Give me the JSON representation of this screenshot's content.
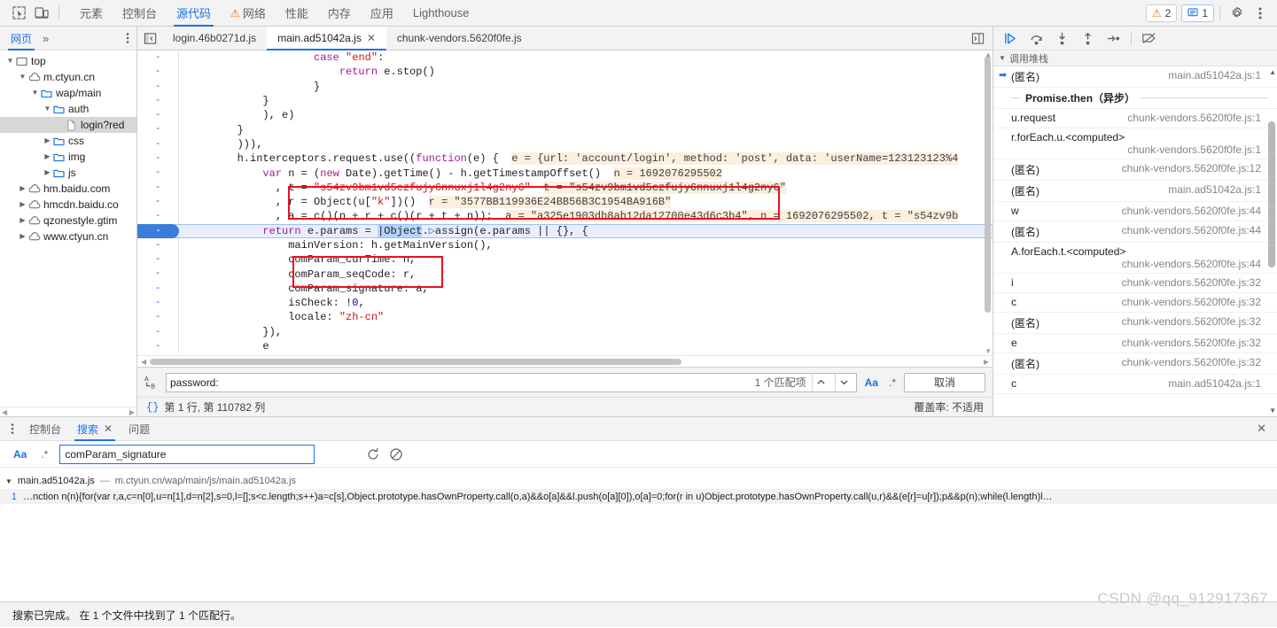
{
  "toolbar": {
    "inspect_icon": "inspect-cursor-icon",
    "device_icon": "device-toolbar-icon",
    "panels": [
      {
        "label": "元素",
        "selected": false,
        "warn": false
      },
      {
        "label": "控制台",
        "selected": false,
        "warn": false
      },
      {
        "label": "源代码",
        "selected": true,
        "warn": false
      },
      {
        "label": "网络",
        "selected": false,
        "warn": true
      },
      {
        "label": "性能",
        "selected": false,
        "warn": false
      },
      {
        "label": "内存",
        "selected": false,
        "warn": false
      },
      {
        "label": "应用",
        "selected": false,
        "warn": false
      },
      {
        "label": "Lighthouse",
        "selected": false,
        "warn": false
      }
    ],
    "warning_count": "2",
    "message_count": "1",
    "settings_icon": "gear-icon",
    "more_icon": "kebab-menu-icon",
    "accent": "#1a73e8",
    "warn_color": "#e37400"
  },
  "navigator": {
    "tab_label": "网页",
    "more_label": "»",
    "tree": [
      {
        "label": "top",
        "indent": 0,
        "twisty": "▼",
        "icon": "frame-icon",
        "selected": false
      },
      {
        "label": "m.ctyun.cn",
        "indent": 1,
        "twisty": "▼",
        "icon": "cloud-icon",
        "selected": false
      },
      {
        "label": "wap/main",
        "indent": 2,
        "twisty": "▼",
        "icon": "folder-icon",
        "selected": false
      },
      {
        "label": "auth",
        "indent": 3,
        "twisty": "▼",
        "icon": "folder-icon",
        "selected": false
      },
      {
        "label": "login?red",
        "indent": 4,
        "twisty": "",
        "icon": "file-icon",
        "selected": true
      },
      {
        "label": "css",
        "indent": 3,
        "twisty": "▶",
        "icon": "folder-icon",
        "selected": false
      },
      {
        "label": "img",
        "indent": 3,
        "twisty": "▶",
        "icon": "folder-icon",
        "selected": false
      },
      {
        "label": "js",
        "indent": 3,
        "twisty": "▶",
        "icon": "folder-icon",
        "selected": false
      },
      {
        "label": "hm.baidu.com",
        "indent": 1,
        "twisty": "▶",
        "icon": "cloud-icon",
        "selected": false
      },
      {
        "label": "hmcdn.baidu.co",
        "indent": 1,
        "twisty": "▶",
        "icon": "cloud-icon",
        "selected": false
      },
      {
        "label": "qzonestyle.gtim",
        "indent": 1,
        "twisty": "▶",
        "icon": "cloud-icon",
        "selected": false
      },
      {
        "label": "www.ctyun.cn",
        "indent": 1,
        "twisty": "▶",
        "icon": "cloud-icon",
        "selected": false
      }
    ]
  },
  "editor": {
    "show_navigator_icon": "show-navigator-icon",
    "split_icon": "split-editor-icon",
    "tabs": [
      {
        "label": "login.46b0271d.js",
        "active": false,
        "closable": false
      },
      {
        "label": "main.ad51042a.js",
        "active": true,
        "closable": true
      },
      {
        "label": "chunk-vendors.5620f0fe.js",
        "active": false,
        "closable": false
      }
    ],
    "lines": [
      {
        "gutter": "-",
        "current": false,
        "segments": [
          {
            "t": "                    ",
            "c": ""
          },
          {
            "t": "case",
            "c": "kw"
          },
          {
            "t": " ",
            "c": ""
          },
          {
            "t": "\"end\"",
            "c": "str"
          },
          {
            "t": ":",
            "c": ""
          }
        ]
      },
      {
        "gutter": "-",
        "current": false,
        "segments": [
          {
            "t": "                        ",
            "c": ""
          },
          {
            "t": "return",
            "c": "kw"
          },
          {
            "t": " e.stop()",
            "c": ""
          }
        ]
      },
      {
        "gutter": "-",
        "current": false,
        "segments": [
          {
            "t": "                    }",
            "c": ""
          }
        ]
      },
      {
        "gutter": "-",
        "current": false,
        "segments": [
          {
            "t": "            }",
            "c": ""
          }
        ]
      },
      {
        "gutter": "-",
        "current": false,
        "segments": [
          {
            "t": "            ), e)",
            "c": ""
          }
        ]
      },
      {
        "gutter": "-",
        "current": false,
        "segments": [
          {
            "t": "        }",
            "c": ""
          }
        ]
      },
      {
        "gutter": "-",
        "current": false,
        "segments": [
          {
            "t": "        ))),",
            "c": ""
          }
        ]
      },
      {
        "gutter": "-",
        "current": false,
        "segments": [
          {
            "t": "        h.interceptors.request.use((",
            "c": ""
          },
          {
            "t": "function",
            "c": "kw"
          },
          {
            "t": "(e) {  ",
            "c": ""
          },
          {
            "t": "e = {url: 'account/login', method: 'post', data: 'userName=123123123%4",
            "c": "hint"
          }
        ]
      },
      {
        "gutter": "-",
        "current": false,
        "segments": [
          {
            "t": "            ",
            "c": ""
          },
          {
            "t": "var",
            "c": "kw"
          },
          {
            "t": " n = (",
            "c": ""
          },
          {
            "t": "new",
            "c": "kw"
          },
          {
            "t": " Date).getTime() - h.getTimestampOffset()  ",
            "c": ""
          },
          {
            "t": "n = 1692076295502",
            "c": "hint"
          }
        ]
      },
      {
        "gutter": "-",
        "current": false,
        "segments": [
          {
            "t": "              , t = ",
            "c": ""
          },
          {
            "t": "\"s54zv9bm1vd5czfujy6nnuxj1l4g2ny6\"",
            "c": "str"
          },
          {
            "t": "  ",
            "c": ""
          },
          {
            "t": "t = \"s54zv9bm1vd5czfujy6nnuxj1l4g2ny6\"",
            "c": "hint"
          }
        ]
      },
      {
        "gutter": "-",
        "current": false,
        "segments": [
          {
            "t": "              , r = Object(u[",
            "c": ""
          },
          {
            "t": "\"k\"",
            "c": "str"
          },
          {
            "t": "])()  ",
            "c": ""
          },
          {
            "t": "r = \"3577BB119936E24BB56B3C1954BA916B\"",
            "c": "hint"
          }
        ]
      },
      {
        "gutter": "-",
        "current": false,
        "segments": [
          {
            "t": "              , a = c()(n + r + c()(r + t + n));  ",
            "c": ""
          },
          {
            "t": "a = \"a325e1903db8ab12da12700e43d6c3b4\", n = 1692076295502, t = \"s54zv9b",
            "c": "hint"
          }
        ]
      },
      {
        "gutter": "-",
        "current": true,
        "segments": [
          {
            "t": "            ",
            "c": ""
          },
          {
            "t": "return",
            "c": "kw"
          },
          {
            "t": " e.params = ",
            "c": ""
          },
          {
            "t": "|",
            "c": "selhl"
          },
          {
            "t": "Object",
            "c": "selhl"
          },
          {
            "t": ".",
            "c": ""
          },
          {
            "t": "▷",
            "c": "caret2"
          },
          {
            "t": "assign(e.params || {}, {",
            "c": ""
          }
        ]
      },
      {
        "gutter": "-",
        "current": false,
        "segments": [
          {
            "t": "                mainVersion: h.getMainVersion(),",
            "c": ""
          }
        ]
      },
      {
        "gutter": "-",
        "current": false,
        "segments": [
          {
            "t": "                comParam_curTime: n,",
            "c": ""
          }
        ]
      },
      {
        "gutter": "-",
        "current": false,
        "segments": [
          {
            "t": "                comParam_seqCode: r,",
            "c": ""
          }
        ]
      },
      {
        "gutter": "-",
        "current": false,
        "segments": [
          {
            "t": "                comParam_signature: a,",
            "c": ""
          }
        ]
      },
      {
        "gutter": "-",
        "current": false,
        "segments": [
          {
            "t": "                isCheck: ",
            "c": ""
          },
          {
            "t": "!",
            "c": ""
          },
          {
            "t": "0",
            "c": "num"
          },
          {
            "t": ",",
            "c": ""
          }
        ]
      },
      {
        "gutter": "-",
        "current": false,
        "segments": [
          {
            "t": "                locale: ",
            "c": ""
          },
          {
            "t": "\"zh-cn\"",
            "c": "str"
          }
        ]
      },
      {
        "gutter": "-",
        "current": false,
        "segments": [
          {
            "t": "            }),",
            "c": ""
          }
        ]
      },
      {
        "gutter": "-",
        "current": false,
        "segments": [
          {
            "t": "            e",
            "c": ""
          }
        ]
      }
    ],
    "annotation_color": "#e81123"
  },
  "find_bar": {
    "case_icon": "match-case-replace-icon",
    "value": "password:",
    "placeholder": "",
    "match_count": "1 个匹配项",
    "prev_icon": "chevron-up-icon",
    "next_icon": "chevron-down-icon",
    "match_case_label": "Aa",
    "regex_label": ".*",
    "cancel_label": "取消"
  },
  "editor_status": {
    "pretty_print_icon": "{}",
    "position": "第 1 行, 第 110782 列",
    "coverage": "覆盖率: 不适用"
  },
  "debugger": {
    "buttons": [
      {
        "icon": "resume-script-icon",
        "name": "resume-button"
      },
      {
        "icon": "step-over-icon",
        "name": "step-over-button"
      },
      {
        "icon": "step-into-icon",
        "name": "step-into-button"
      },
      {
        "icon": "step-out-icon",
        "name": "step-out-button"
      },
      {
        "icon": "step-icon",
        "name": "step-button"
      },
      {
        "icon": "deactivate-breakpoints-icon",
        "name": "deactivate-breakpoints-button"
      }
    ],
    "callstack_title": "调用堆栈",
    "frames": [
      {
        "name": "(匿名)",
        "loc": "main.ad51042a.js:1",
        "active": true,
        "wrap": false,
        "async": false
      },
      {
        "name": "Promise.then（异步）",
        "loc": "",
        "active": false,
        "wrap": false,
        "async": true
      },
      {
        "name": "u.request",
        "loc": "chunk-vendors.5620f0fe.js:1",
        "active": false,
        "wrap": false,
        "async": false
      },
      {
        "name": "r.forEach.u.<computed>",
        "loc": "chunk-vendors.5620f0fe.js:1",
        "active": false,
        "wrap": true,
        "async": false
      },
      {
        "name": "(匿名)",
        "loc": "chunk-vendors.5620f0fe.js:12",
        "active": false,
        "wrap": false,
        "async": false
      },
      {
        "name": "(匿名)",
        "loc": "main.ad51042a.js:1",
        "active": false,
        "wrap": false,
        "async": false
      },
      {
        "name": "w",
        "loc": "chunk-vendors.5620f0fe.js:44",
        "active": false,
        "wrap": false,
        "async": false
      },
      {
        "name": "(匿名)",
        "loc": "chunk-vendors.5620f0fe.js:44",
        "active": false,
        "wrap": false,
        "async": false
      },
      {
        "name": "A.forEach.t.<computed>",
        "loc": "chunk-vendors.5620f0fe.js:44",
        "active": false,
        "wrap": true,
        "async": false
      },
      {
        "name": "i",
        "loc": "chunk-vendors.5620f0fe.js:32",
        "active": false,
        "wrap": false,
        "async": false
      },
      {
        "name": "c",
        "loc": "chunk-vendors.5620f0fe.js:32",
        "active": false,
        "wrap": false,
        "async": false
      },
      {
        "name": "(匿名)",
        "loc": "chunk-vendors.5620f0fe.js:32",
        "active": false,
        "wrap": false,
        "async": false
      },
      {
        "name": "e",
        "loc": "chunk-vendors.5620f0fe.js:32",
        "active": false,
        "wrap": false,
        "async": false
      },
      {
        "name": "(匿名)",
        "loc": "chunk-vendors.5620f0fe.js:32",
        "active": false,
        "wrap": false,
        "async": false
      },
      {
        "name": "c",
        "loc": "main.ad51042a.js:1",
        "active": false,
        "wrap": false,
        "async": false
      }
    ]
  },
  "drawer": {
    "more_icon": "kebab-menu-icon",
    "tabs": [
      {
        "label": "控制台",
        "active": false,
        "closable": false
      },
      {
        "label": "搜索",
        "active": true,
        "closable": true
      },
      {
        "label": "问题",
        "active": false,
        "closable": false
      }
    ],
    "close_icon": "close-icon",
    "search": {
      "match_case_label": "Aa",
      "regex_label": ".*",
      "value": "comParam_signature",
      "placeholder": "",
      "refresh_icon": "refresh-icon",
      "clear_icon": "clear-icon"
    },
    "results": [
      {
        "twisty": "▼",
        "file": "main.ad51042a.js",
        "dash": "—",
        "url": "m.ctyun.cn/wap/main/js/main.ad51042a.js",
        "lines": [
          {
            "num": "1",
            "text": "…nction n(n){for(var r,a,c=n[0],u=n[1],d=n[2],s=0,l=[];s<c.length;s++)a=c[s],Object.prototype.hasOwnProperty.call(o,a)&&o[a]&&l.push(o[a][0]),o[a]=0;for(r in u)Object.prototype.hasOwnProperty.call(u,r)&&(e[r]=u[r]);p&&p(n);while(l.length)l…"
          }
        ]
      }
    ]
  },
  "status_bar": {
    "text": "搜索已完成。  在 1 个文件中找到了 1 个匹配行。"
  },
  "watermark": "CSDN @qq_912917367"
}
